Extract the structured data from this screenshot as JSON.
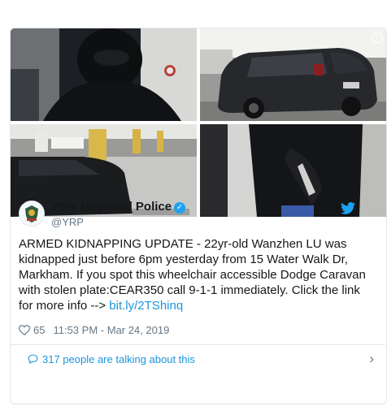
{
  "tweet": {
    "display_name": "York Regional Police",
    "handle": "@YRP",
    "text_main": "ARMED KIDNAPPING UPDATE - 22yr-old Wanzhen LU was kidnapped just before 6pm yesterday from 15 Water Walk Dr, Markham. If you spot this wheelchair accessible Dodge Caravan with stolen plate:CEAR350 call 9-1-1 immediately. Click the link for more info --> ",
    "link": "bit.ly/2TShinq",
    "likes": "65",
    "timestamp": "11:53 PM - Mar 24, 2019"
  },
  "talking_label": "317 people are talking about this",
  "colors": {
    "accent": "#1da1f2",
    "link": "#1b95e0",
    "muted": "#657786",
    "border": "#e1e8ed"
  },
  "icons": [
    "info-icon",
    "verified-badge-icon",
    "twitter-bird-icon",
    "heart-icon",
    "speech-bubble-icon",
    "chevron-right-icon"
  ]
}
